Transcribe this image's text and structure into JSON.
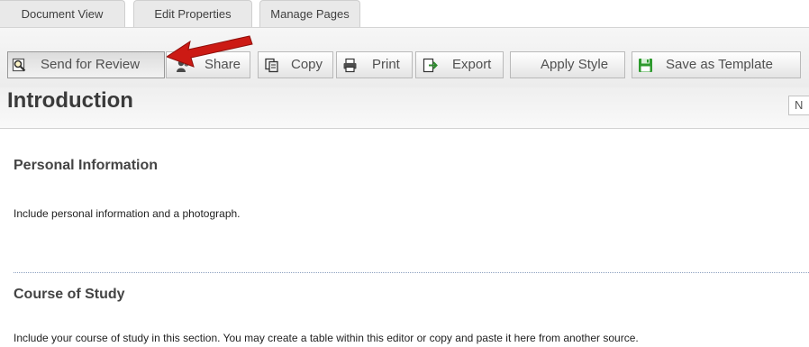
{
  "tabs": [
    {
      "label": "Document View"
    },
    {
      "label": "Edit Properties"
    },
    {
      "label": "Manage Pages"
    }
  ],
  "toolbar": {
    "send_for_review": "Send for Review",
    "share": "Share",
    "copy": "Copy",
    "print": "Print",
    "export": "Export",
    "apply_style": "Apply Style",
    "save_as_template": "Save as Template"
  },
  "icons": {
    "send_for_review": "magnifier-page-icon",
    "share": "share-icon",
    "copy": "copy-icon",
    "print": "printer-icon",
    "export": "export-icon",
    "save_as_template": "floppy-disk-icon",
    "annotation": "red-arrow-icon"
  },
  "colors": {
    "arrow": "#cc1a14",
    "save_icon": "#2e9a2e"
  },
  "page": {
    "title": "Introduction",
    "side_button": "N"
  },
  "sections": [
    {
      "heading": "Personal Information",
      "text": "Include personal information and a photograph."
    },
    {
      "heading": "Course of Study",
      "text": "Include your course of study in this section.  You may create a table within this editor or copy and paste it here from another source."
    }
  ]
}
